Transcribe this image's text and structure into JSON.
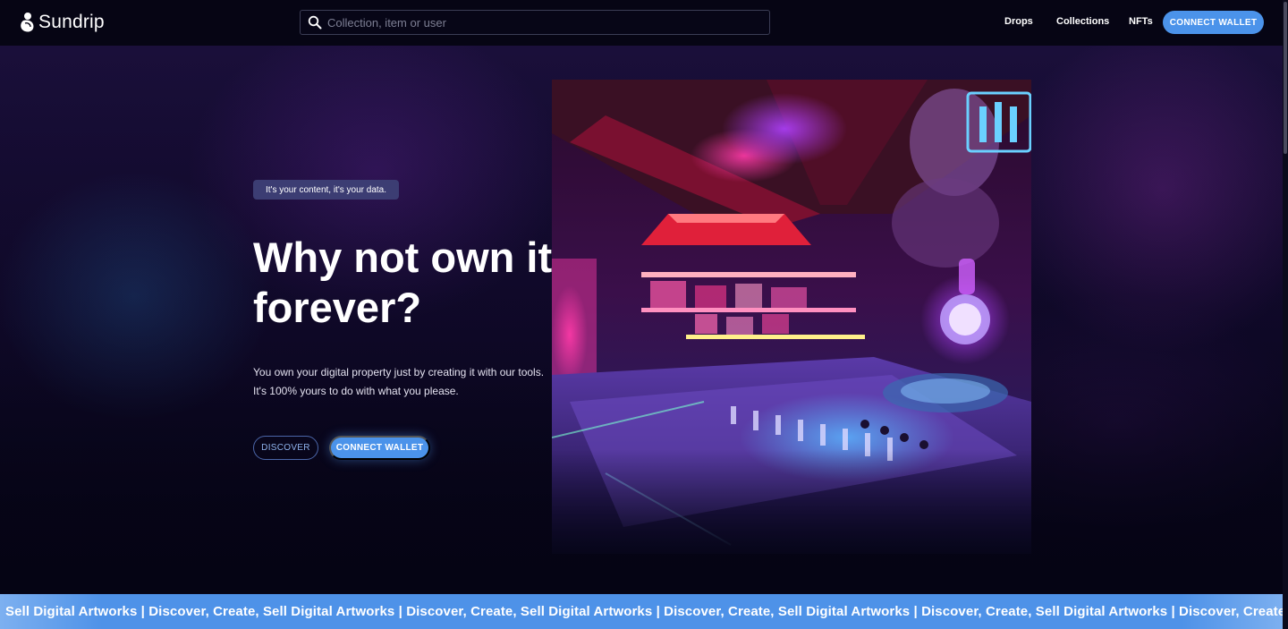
{
  "header": {
    "logo_text": "Sundrip",
    "search_placeholder": "Collection, item or user",
    "nav": [
      "Drops",
      "Collections",
      "NFTs"
    ],
    "connect_wallet": "CONNECT WALLET"
  },
  "hero": {
    "badge": "It's your content, it's your data.",
    "headline": "Why not own it forever?",
    "description_line1": "You own your digital property just by creating it with our tools.",
    "description_line2": "It's 100% yours to do with what you please.",
    "discover_button": "DISCOVER",
    "connect_wallet_button": "CONNECT WALLET"
  },
  "marquee": {
    "text": "Sell Digital Artworks | Discover, Create, Sell Digital Artworks | Discover, Create, Sell Digital Artworks | Discover, Create, Sell Digital Artworks | Discover, Create, Sell Digital Artworks | Discover, Create, Sell Digital Artworks | Disco"
  },
  "colors": {
    "accent": "#4b93ea",
    "background": "#07061a",
    "badge": "#3c3d73"
  }
}
